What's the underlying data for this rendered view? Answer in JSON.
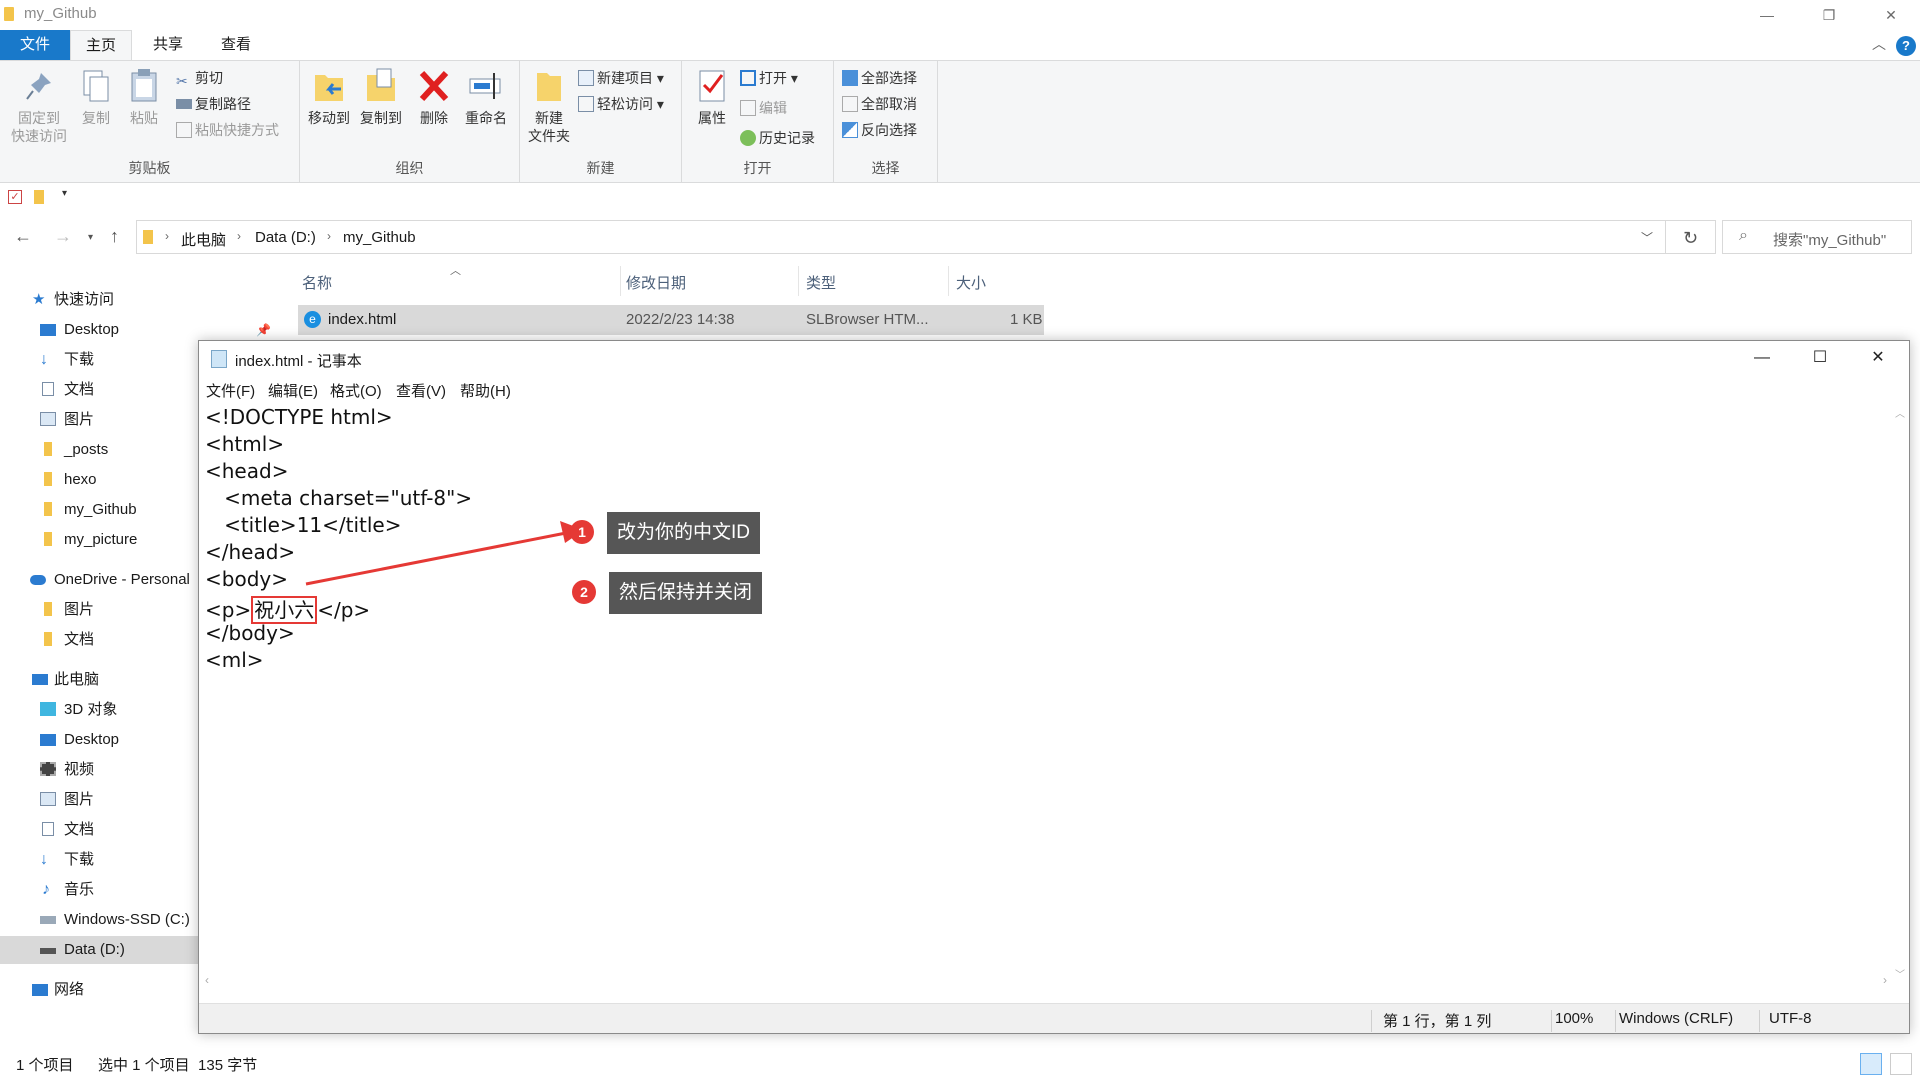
{
  "explorer": {
    "title": "my_Github",
    "tabs": [
      "文件",
      "主页",
      "共享",
      "查看"
    ],
    "ribbon": {
      "clipboard": {
        "label": "剪贴板",
        "pin": "固定到\n快速访问",
        "pin_l1": "固定到",
        "pin_l2": "快速访问",
        "copy": "复制",
        "paste": "粘贴",
        "cut": "剪切",
        "copy_path": "复制路径",
        "paste_shortcut": "粘贴快捷方式"
      },
      "organize": {
        "label": "组织",
        "move_to": "移动到",
        "copy_to": "复制到",
        "delete": "删除",
        "rename": "重命名"
      },
      "new": {
        "label": "新建",
        "new_folder_l1": "新建",
        "new_folder_l2": "文件夹",
        "new_item": "新建项目",
        "easy_access": "轻松访问"
      },
      "open": {
        "label": "打开",
        "properties": "属性",
        "open": "打开",
        "edit": "编辑",
        "history": "历史记录"
      },
      "select": {
        "label": "选择",
        "select_all": "全部选择",
        "select_none": "全部取消",
        "invert": "反向选择"
      }
    },
    "address": {
      "crumbs": [
        "此电脑",
        "Data (D:)",
        "my_Github"
      ]
    },
    "search_placeholder": "搜索\"my_Github\"",
    "nav": {
      "quick_access": "快速访问",
      "items": [
        "Desktop",
        "下载",
        "文档",
        "图片",
        "_posts",
        "hexo",
        "my_Github",
        "my_picture"
      ],
      "onedrive": "OneDrive - Personal",
      "onedrive_items": [
        "图片",
        "文档"
      ],
      "this_pc": "此电脑",
      "pc_items": [
        "3D 对象",
        "Desktop",
        "视频",
        "图片",
        "文档",
        "下载",
        "音乐",
        "Windows-SSD (C:)",
        "Data (D:)"
      ],
      "network": "网络"
    },
    "columns": [
      "名称",
      "修改日期",
      "类型",
      "大小"
    ],
    "file": {
      "name": "index.html",
      "date": "2022/2/23 14:38",
      "type": "SLBrowser HTM...",
      "size": "1 KB"
    },
    "status": {
      "count": "1 个项目",
      "selected": "选中 1 个项目  135 字节"
    }
  },
  "notepad": {
    "title": "index.html - 记事本",
    "menu": [
      "文件(F)",
      "编辑(E)",
      "格式(O)",
      "查看(V)",
      "帮助(H)"
    ],
    "lines": {
      "l1": "<!DOCTYPE html>",
      "l2": "<html>",
      "l3": "<head>",
      "l4": "   <meta charset=\"utf-8\">",
      "l5": "   <title>11</title>",
      "l6": "</head>",
      "l7": "<body>",
      "l8_pre": "<p>",
      "l8_mid": "祝小六",
      "l8_post": "</p>",
      "l9": "</body>",
      "l10": "<ml>"
    },
    "status": {
      "position": "第 1 行，第 1 列",
      "zoom": "100%",
      "eol": "Windows (CRLF)",
      "encoding": "UTF-8"
    }
  },
  "annotations": [
    {
      "num": "1",
      "text": "改为你的中文ID"
    },
    {
      "num": "2",
      "text": "然后保持并关闭"
    }
  ],
  "colors": {
    "accent": "#1979ca",
    "annotation_red": "#e53935",
    "callout_bg": "#565656"
  }
}
